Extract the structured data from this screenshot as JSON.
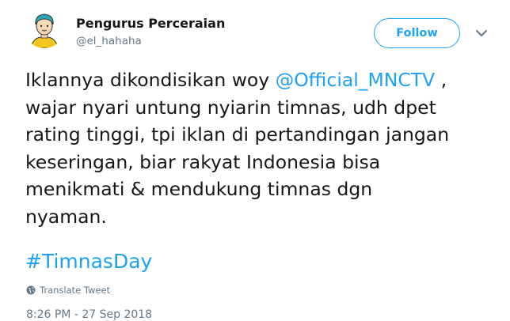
{
  "author": {
    "display_name": "Pengurus Perceraian",
    "handle": "@el_hahaha",
    "avatar_icon": "cartoon-avatar-icon"
  },
  "actions": {
    "follow_label": "Follow",
    "menu_icon": "chevron-down-icon"
  },
  "tweet": {
    "line1_before": "Iklannya dikondisikan woy ",
    "mention": "@Official_MNCTV",
    "line1_after": " ,",
    "line2": "wajar nyari untung nyiarin timnas, udh dpet",
    "line3": "rating tinggi, tpi iklan di pertandingan jangan",
    "line4": "keseringan, biar rakyat Indonesia bisa",
    "line5": "menikmati & mendukung timnas dgn",
    "line6": "nyaman.",
    "hashtag": "#TimnasDay"
  },
  "translate": {
    "label": "Translate Tweet",
    "icon": "globe-icon"
  },
  "meta": {
    "timestamp": "8:26 PM - 27 Sep 2018"
  },
  "colors": {
    "accent": "#1da1f2",
    "text": "#14171a",
    "secondary": "#657786"
  }
}
